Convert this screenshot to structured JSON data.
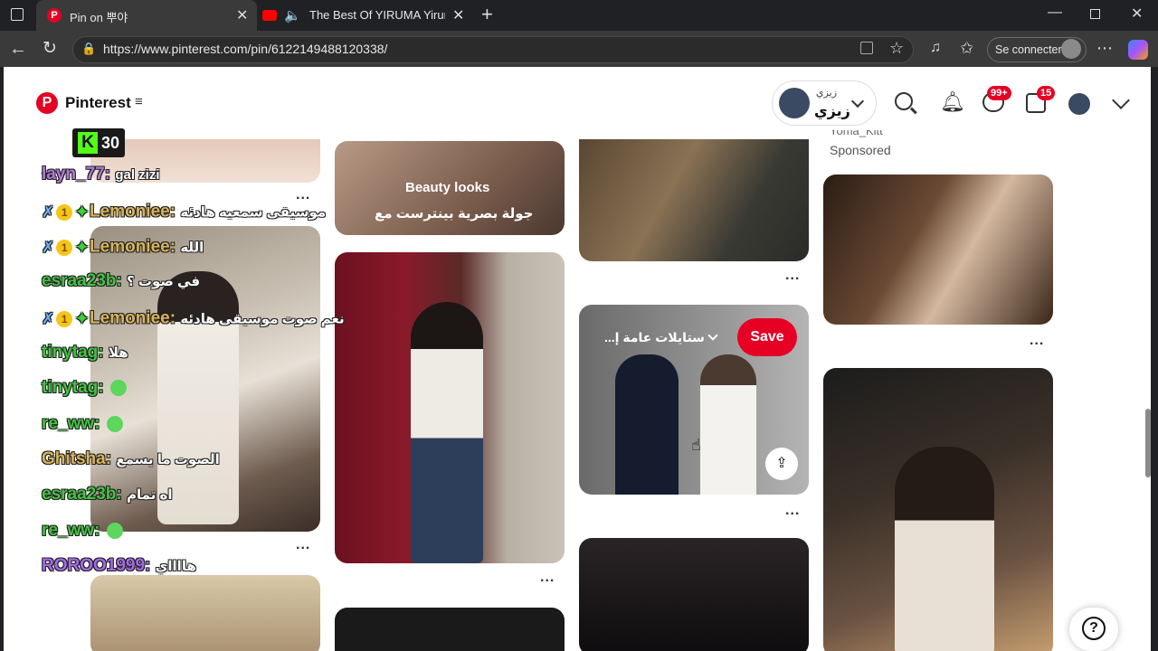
{
  "browser": {
    "tabs": [
      {
        "title": "Pin on 뿌야",
        "active": true,
        "icon": "pinterest-icon"
      },
      {
        "title": "The Best Of YIRUMA Yiruma's",
        "active": false,
        "icon": "youtube-icon"
      }
    ],
    "url": "https://www.pinterest.com/pin/6122149488120338/",
    "signin_label": "Se connecter"
  },
  "header": {
    "logo_text": "Pinterest",
    "account_name_top": "زيزي",
    "account_name": "زيزي",
    "messages_badge": "99+",
    "updates_badge": "15"
  },
  "pins": {
    "beauty_title": "Beauty looks",
    "beauty_subtitle": "جولة بصرية بينترست مع",
    "sponsor_name": "Yoma_Kitt",
    "sponsored_label": "Sponsored",
    "board_name": "...ستايلات عامة إ",
    "save_label": "Save",
    "more_label": "..."
  },
  "stream": {
    "badge_letter": "K",
    "viewer_count": "30",
    "chat": [
      {
        "user": "layn_77",
        "color": "#b07ad6",
        "text": "gal zizi",
        "badges": []
      },
      {
        "user": "Lemoniee",
        "color": "#d8b45a",
        "text": "موسيقى سمعيه هادئه",
        "badges": [
          "sword",
          "coin",
          "spark"
        ]
      },
      {
        "user": "Lemoniee",
        "color": "#d8b45a",
        "text": "الله",
        "badges": [
          "sword",
          "coin",
          "spark"
        ]
      },
      {
        "user": "esraa23b",
        "color": "#43c343",
        "text": "في صوت ؟",
        "badges": []
      },
      {
        "user": "Lemoniee",
        "color": "#d8b45a",
        "text": "نعم صوت موسيقى هادئه",
        "badges": [
          "sword",
          "coin",
          "spark"
        ]
      },
      {
        "user": "tinytag",
        "color": "#43c343",
        "text": "هلا",
        "badges": []
      },
      {
        "user": "tinytag",
        "color": "#43c343",
        "text": "",
        "badges": [
          "emote"
        ]
      },
      {
        "user": "re_ww",
        "color": "#43c343",
        "text": "",
        "badges": [
          "emote"
        ]
      },
      {
        "user": "Ghitsha",
        "color": "#d8b45a",
        "text": "الصوت ما يسمع",
        "badges": []
      },
      {
        "user": "esraa23b",
        "color": "#43c343",
        "text": "اه تمام",
        "badges": []
      },
      {
        "user": "re_ww",
        "color": "#43c343",
        "text": "",
        "badges": [
          "emote"
        ]
      },
      {
        "user": "ROROO1999",
        "color": "#a46ae6",
        "text": "هااااي",
        "badges": []
      }
    ]
  },
  "help_label": "?"
}
